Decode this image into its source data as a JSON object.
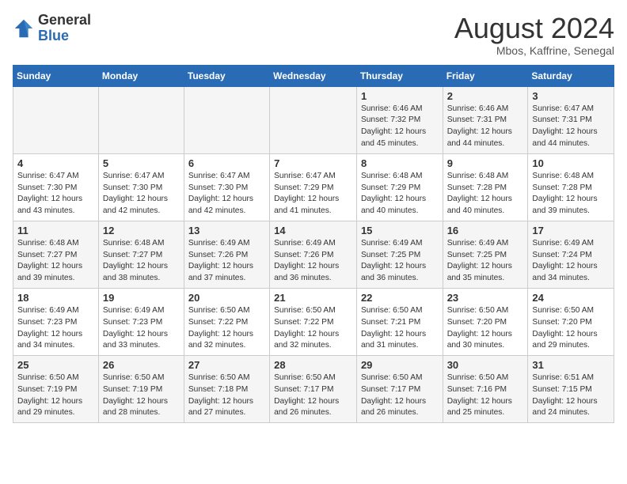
{
  "header": {
    "logo_general": "General",
    "logo_blue": "Blue",
    "title": "August 2024",
    "subtitle": "Mbos, Kaffrine, Senegal"
  },
  "days_of_week": [
    "Sunday",
    "Monday",
    "Tuesday",
    "Wednesday",
    "Thursday",
    "Friday",
    "Saturday"
  ],
  "weeks": [
    [
      {
        "day": "",
        "info": ""
      },
      {
        "day": "",
        "info": ""
      },
      {
        "day": "",
        "info": ""
      },
      {
        "day": "",
        "info": ""
      },
      {
        "day": "1",
        "info": "Sunrise: 6:46 AM\nSunset: 7:32 PM\nDaylight: 12 hours and 45 minutes."
      },
      {
        "day": "2",
        "info": "Sunrise: 6:46 AM\nSunset: 7:31 PM\nDaylight: 12 hours and 44 minutes."
      },
      {
        "day": "3",
        "info": "Sunrise: 6:47 AM\nSunset: 7:31 PM\nDaylight: 12 hours and 44 minutes."
      }
    ],
    [
      {
        "day": "4",
        "info": "Sunrise: 6:47 AM\nSunset: 7:30 PM\nDaylight: 12 hours and 43 minutes."
      },
      {
        "day": "5",
        "info": "Sunrise: 6:47 AM\nSunset: 7:30 PM\nDaylight: 12 hours and 42 minutes."
      },
      {
        "day": "6",
        "info": "Sunrise: 6:47 AM\nSunset: 7:30 PM\nDaylight: 12 hours and 42 minutes."
      },
      {
        "day": "7",
        "info": "Sunrise: 6:47 AM\nSunset: 7:29 PM\nDaylight: 12 hours and 41 minutes."
      },
      {
        "day": "8",
        "info": "Sunrise: 6:48 AM\nSunset: 7:29 PM\nDaylight: 12 hours and 40 minutes."
      },
      {
        "day": "9",
        "info": "Sunrise: 6:48 AM\nSunset: 7:28 PM\nDaylight: 12 hours and 40 minutes."
      },
      {
        "day": "10",
        "info": "Sunrise: 6:48 AM\nSunset: 7:28 PM\nDaylight: 12 hours and 39 minutes."
      }
    ],
    [
      {
        "day": "11",
        "info": "Sunrise: 6:48 AM\nSunset: 7:27 PM\nDaylight: 12 hours and 39 minutes."
      },
      {
        "day": "12",
        "info": "Sunrise: 6:48 AM\nSunset: 7:27 PM\nDaylight: 12 hours and 38 minutes."
      },
      {
        "day": "13",
        "info": "Sunrise: 6:49 AM\nSunset: 7:26 PM\nDaylight: 12 hours and 37 minutes."
      },
      {
        "day": "14",
        "info": "Sunrise: 6:49 AM\nSunset: 7:26 PM\nDaylight: 12 hours and 36 minutes."
      },
      {
        "day": "15",
        "info": "Sunrise: 6:49 AM\nSunset: 7:25 PM\nDaylight: 12 hours and 36 minutes."
      },
      {
        "day": "16",
        "info": "Sunrise: 6:49 AM\nSunset: 7:25 PM\nDaylight: 12 hours and 35 minutes."
      },
      {
        "day": "17",
        "info": "Sunrise: 6:49 AM\nSunset: 7:24 PM\nDaylight: 12 hours and 34 minutes."
      }
    ],
    [
      {
        "day": "18",
        "info": "Sunrise: 6:49 AM\nSunset: 7:23 PM\nDaylight: 12 hours and 34 minutes."
      },
      {
        "day": "19",
        "info": "Sunrise: 6:49 AM\nSunset: 7:23 PM\nDaylight: 12 hours and 33 minutes."
      },
      {
        "day": "20",
        "info": "Sunrise: 6:50 AM\nSunset: 7:22 PM\nDaylight: 12 hours and 32 minutes."
      },
      {
        "day": "21",
        "info": "Sunrise: 6:50 AM\nSunset: 7:22 PM\nDaylight: 12 hours and 32 minutes."
      },
      {
        "day": "22",
        "info": "Sunrise: 6:50 AM\nSunset: 7:21 PM\nDaylight: 12 hours and 31 minutes."
      },
      {
        "day": "23",
        "info": "Sunrise: 6:50 AM\nSunset: 7:20 PM\nDaylight: 12 hours and 30 minutes."
      },
      {
        "day": "24",
        "info": "Sunrise: 6:50 AM\nSunset: 7:20 PM\nDaylight: 12 hours and 29 minutes."
      }
    ],
    [
      {
        "day": "25",
        "info": "Sunrise: 6:50 AM\nSunset: 7:19 PM\nDaylight: 12 hours and 29 minutes."
      },
      {
        "day": "26",
        "info": "Sunrise: 6:50 AM\nSunset: 7:19 PM\nDaylight: 12 hours and 28 minutes."
      },
      {
        "day": "27",
        "info": "Sunrise: 6:50 AM\nSunset: 7:18 PM\nDaylight: 12 hours and 27 minutes."
      },
      {
        "day": "28",
        "info": "Sunrise: 6:50 AM\nSunset: 7:17 PM\nDaylight: 12 hours and 26 minutes."
      },
      {
        "day": "29",
        "info": "Sunrise: 6:50 AM\nSunset: 7:17 PM\nDaylight: 12 hours and 26 minutes."
      },
      {
        "day": "30",
        "info": "Sunrise: 6:50 AM\nSunset: 7:16 PM\nDaylight: 12 hours and 25 minutes."
      },
      {
        "day": "31",
        "info": "Sunrise: 6:51 AM\nSunset: 7:15 PM\nDaylight: 12 hours and 24 minutes."
      }
    ]
  ]
}
